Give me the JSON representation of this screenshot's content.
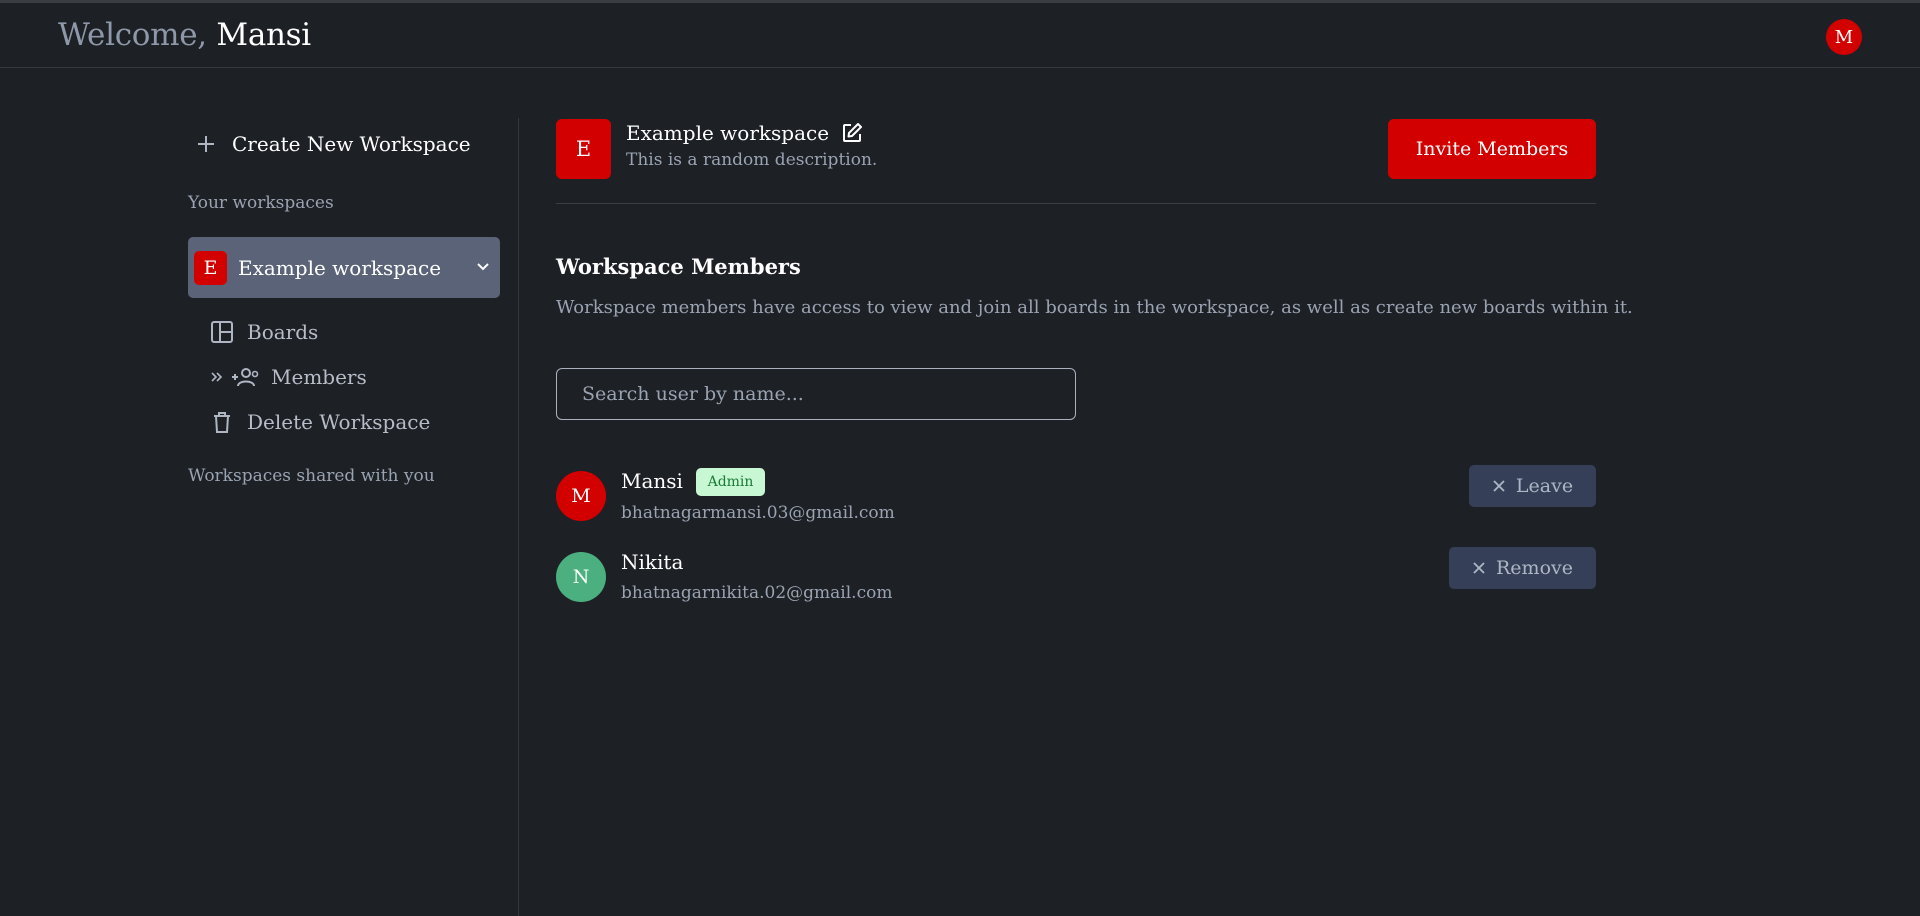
{
  "header": {
    "greeting": "Welcome,",
    "user_name": "Mansi",
    "avatar_initial": "M"
  },
  "sidebar": {
    "create_label": "Create New Workspace",
    "your_workspaces_label": "Your workspaces",
    "workspace": {
      "initial": "E",
      "name": "Example workspace",
      "items": [
        {
          "label": "Boards",
          "icon": "boards-icon"
        },
        {
          "label": "Members",
          "icon": "members-icon"
        },
        {
          "label": "Delete Workspace",
          "icon": "trash-icon"
        }
      ]
    },
    "shared_label": "Workspaces shared with you"
  },
  "main": {
    "workspace_initial": "E",
    "workspace_name": "Example workspace",
    "workspace_description": "This is a random description.",
    "invite_label": "Invite Members",
    "members_title": "Workspace Members",
    "members_description": "Workspace members have access to view and join all boards in the workspace, as well as create new boards within it.",
    "search_placeholder": "Search user by name...",
    "members": [
      {
        "initial": "M",
        "name": "Mansi",
        "badge": "Admin",
        "email": "bhatnagarmansi.03@gmail.com",
        "action": "Leave",
        "avatar_color": "#d30000"
      },
      {
        "initial": "N",
        "name": "Nikita",
        "email": "bhatnagarnikita.02@gmail.com",
        "action": "Remove",
        "avatar_color": "#4caf7f"
      }
    ]
  },
  "colors": {
    "background": "#1d2025",
    "accent": "#d30000",
    "selected_workspace": "#5b6378",
    "secondary_button": "#354058"
  }
}
